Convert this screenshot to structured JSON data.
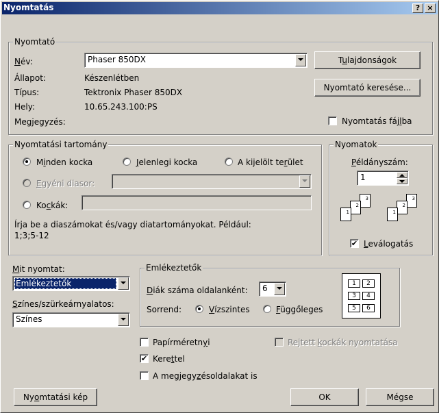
{
  "title": "Nyomtatás",
  "titlebar_buttons": {
    "help": "?",
    "close": "×"
  },
  "printer": {
    "group": "Nyomtató",
    "name_label": "Név:",
    "name_value": "Phaser 850DX",
    "status_label": "Állapot:",
    "status_value": "Készenlétben",
    "type_label": "Típus:",
    "type_value": "Tektronix Phaser 850DX",
    "where_label": "Hely:",
    "where_value": "10.65.243.100:PS",
    "comment_label": "Megjegyzés:",
    "properties_btn": "Tulajdonságok",
    "find_btn": "Nyomtató keresése...",
    "print_to_file": "Nyomtatás fájlba"
  },
  "range": {
    "group": "Nyomtatási tartomány",
    "all": "Minden kocka",
    "current": "Jelenlegi kocka",
    "selection": "A kijelölt terület",
    "custom": "Egyéni diasor:",
    "slides": "Kockák:",
    "hint": "Írja be a diaszámokat és/vagy diatartományokat. Például:",
    "hint2": "1;3;5-12"
  },
  "copies": {
    "group": "Nyomatok",
    "count_label": "Példányszám:",
    "count_value": "1",
    "collate": "Leválogatás",
    "pages": [
      "1",
      "2",
      "3"
    ]
  },
  "print_what": {
    "label": "Mit nyomtat:",
    "value": "Emlékeztetők",
    "color_label": "Színes/szürkeárnyalatos:",
    "color_value": "Színes"
  },
  "handouts": {
    "group": "Emlékeztetők",
    "per_page_label": "Diák száma oldalanként:",
    "per_page_value": "6",
    "order_label": "Sorrend:",
    "horizontal": "Vízszintes",
    "vertical": "Függőleges",
    "grid": [
      "1",
      "2",
      "3",
      "4",
      "5",
      "6"
    ]
  },
  "options": {
    "scale": "Papírméretnyi",
    "hidden": "Rejtett kockák nyomtatása",
    "frame": "Kerettel",
    "comments": "A megjegyzésoldalakat is"
  },
  "footer": {
    "preview": "Nyomtatási kép",
    "ok": "OK",
    "cancel": "Mégse"
  }
}
